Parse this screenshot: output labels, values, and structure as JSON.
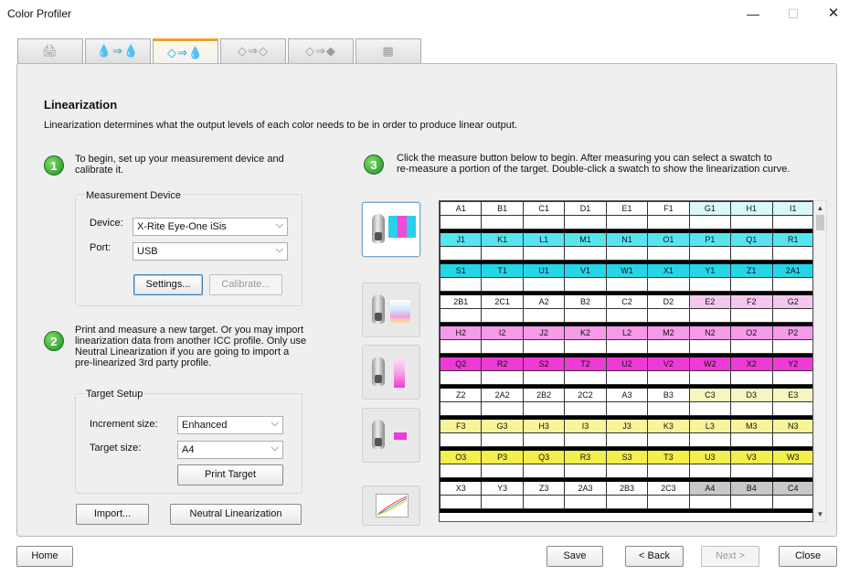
{
  "window": {
    "title": "Color Profiler",
    "minimize": "—",
    "maximize": "☐",
    "close": "✕"
  },
  "tabs": [
    {
      "icon": "printer-icon",
      "glyph": "🖨"
    },
    {
      "icon": "drops-to-drops-icon",
      "glyph": "💧⇒💧"
    },
    {
      "icon": "drops-outline-to-drops-icon",
      "glyph": "◇⇒💧"
    },
    {
      "icon": "drops-gray-icon",
      "glyph": "◇⇒◇"
    },
    {
      "icon": "drops-gray-dark-icon",
      "glyph": "◇⇒◆"
    },
    {
      "icon": "grid-icon",
      "glyph": "▦"
    }
  ],
  "heading": "Linearization",
  "subheading": "Linearization determines what the output levels of each color needs to be in order to produce linear output.",
  "step1": {
    "number": "1",
    "text1": "To begin, set up your measurement device and",
    "text2": "calibrate it."
  },
  "measurement": {
    "title": "Measurement Device",
    "device_label": "Device:",
    "device_value": "X-Rite Eye-One iSis",
    "port_label": "Port:",
    "port_value": "USB",
    "settings_button": "Settings...",
    "calibrate_button": "Calibrate..."
  },
  "step2": {
    "number": "2",
    "lines": [
      "Print and measure a new target. Or you may import",
      "linearization data from another ICC profile. Only use",
      "Neutral Linearization if you are going to import a",
      "pre-linearized 3rd party profile."
    ]
  },
  "target": {
    "title": "Target Setup",
    "increment_label": "Increment size:",
    "increment_value": "Enhanced",
    "size_label": "Target size:",
    "size_value": "A4",
    "print_button": "Print Target"
  },
  "import_button": "Import...",
  "neutral_button": "Neutral Linearization",
  "step3": {
    "number": "3",
    "text1": "Click the measure button below to begin. After measuring you can select a swatch to",
    "text2": "re-measure a portion of the target. Double-click a swatch to show the linearization curve."
  },
  "swatch_rows": [
    {
      "color": "#ffffff",
      "cells": [
        "A1",
        "B1",
        "C1",
        "D1",
        "E1",
        "F1",
        "G1",
        "H1",
        "I1"
      ],
      "fade": "#d9f8fb"
    },
    {
      "color": "#57e4f0",
      "cells": [
        "J1",
        "K1",
        "L1",
        "M1",
        "N1",
        "O1",
        "P1",
        "Q1",
        "R1"
      ]
    },
    {
      "color": "#25d6e8",
      "cells": [
        "S1",
        "T1",
        "U1",
        "V1",
        "W1",
        "X1",
        "Y1",
        "Z1",
        "2A1"
      ]
    },
    {
      "color": "#ffffff",
      "cells": [
        "2B1",
        "2C1",
        "A2",
        "B2",
        "C2",
        "D2",
        "E2",
        "F2",
        "G2"
      ],
      "fade": "#f6c6ef"
    },
    {
      "color": "#f59ae8",
      "cells": [
        "H2",
        "I2",
        "J2",
        "K2",
        "L2",
        "M2",
        "N2",
        "O2",
        "P2"
      ]
    },
    {
      "color": "#ee3ad6",
      "cells": [
        "Q2",
        "R2",
        "S2",
        "T2",
        "U2",
        "V2",
        "W2",
        "X2",
        "Y2"
      ]
    },
    {
      "color": "#ffffff",
      "cells": [
        "Z2",
        "2A2",
        "2B2",
        "2C2",
        "A3",
        "B3",
        "C3",
        "D3",
        "E3"
      ],
      "fade": "#f8f6c0"
    },
    {
      "color": "#f8f49a",
      "cells": [
        "F3",
        "G3",
        "H3",
        "I3",
        "J3",
        "K3",
        "L3",
        "M3",
        "N3"
      ]
    },
    {
      "color": "#f3ef4c",
      "cells": [
        "O3",
        "P3",
        "Q3",
        "R3",
        "S3",
        "T3",
        "U3",
        "V3",
        "W3"
      ]
    },
    {
      "color": "#ffffff",
      "cells": [
        "X3",
        "Y3",
        "Z3",
        "2A3",
        "2B3",
        "2C3",
        "A4",
        "B4",
        "C4"
      ],
      "fade": "#c8c8c8"
    }
  ],
  "footer": {
    "home": "Home",
    "save": "Save",
    "back": "< Back",
    "next": "Next >",
    "close": "Close"
  }
}
